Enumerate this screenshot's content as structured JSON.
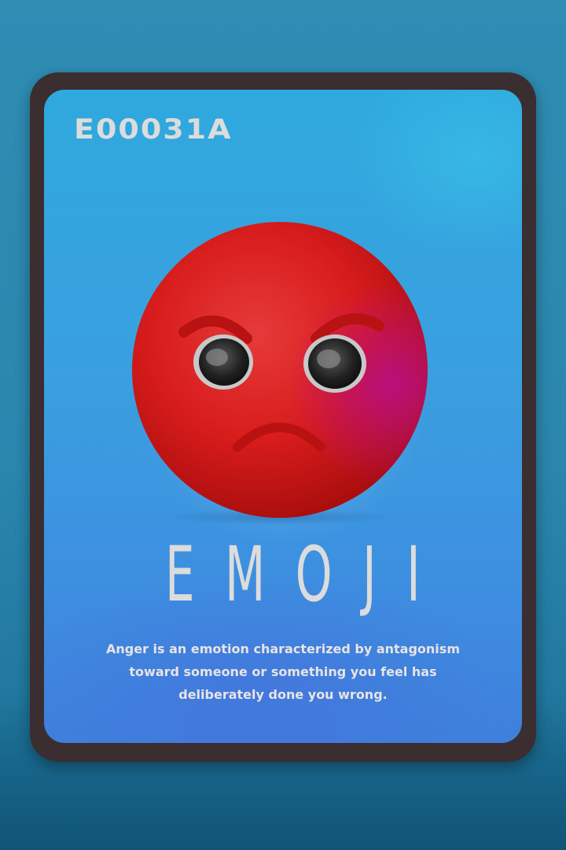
{
  "card": {
    "code": "E00031A",
    "title": "EMOJI",
    "description": "Anger is an emotion characterized by antagonism toward someone or something you feel has deliberately done you wrong."
  },
  "emoji": {
    "icon": "angry-face-icon",
    "face_color": "#d81c1c",
    "accent_color": "#b80f82"
  },
  "colors": {
    "background": "#2a86ad",
    "frame": "#3a2e30",
    "card": "#3a9fdf",
    "text": "#dcdcdc"
  }
}
